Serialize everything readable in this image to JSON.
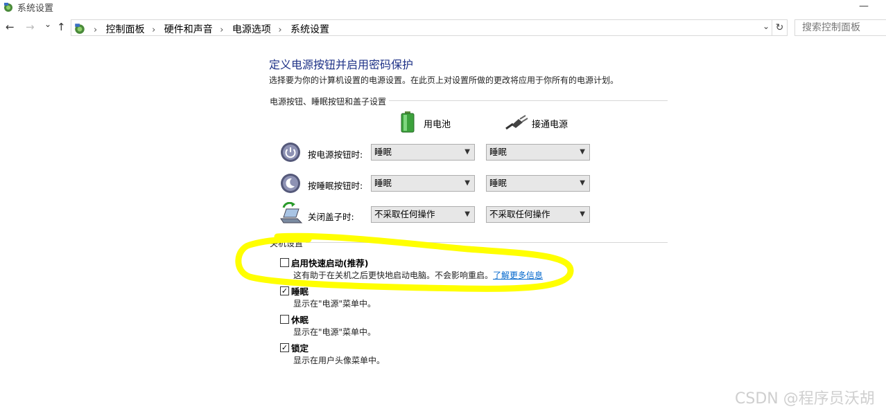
{
  "window": {
    "title": "系统设置",
    "minimize_glyph": "—"
  },
  "nav": {
    "back": "←",
    "forward": "→",
    "recent": "⌄",
    "up": "↑",
    "breadcrumbs": [
      "控制面板",
      "硬件和声音",
      "电源选项",
      "系统设置"
    ],
    "separator": "›",
    "dropdown_glyph": "⌄",
    "refresh_glyph": "↻",
    "search_placeholder": "搜索控制面板"
  },
  "page": {
    "heading": "定义电源按钮并启用密码保护",
    "description": "选择要为你的计算机设置的电源设置。在此页上对设置所做的更改将应用于你所有的电源计划。"
  },
  "power_buttons": {
    "group_label": "电源按钮、睡眠按钮和盖子设置",
    "columns": {
      "battery": "用电池",
      "plugged_in": "接通电源"
    },
    "rows": [
      {
        "icon": "power-button-icon",
        "label": "按电源按钮时:",
        "battery": "睡眠",
        "plugged_in": "睡眠"
      },
      {
        "icon": "sleep-button-icon",
        "label": "按睡眠按钮时:",
        "battery": "睡眠",
        "plugged_in": "睡眠"
      },
      {
        "icon": "laptop-lid-icon",
        "label": "关闭盖子时:",
        "battery": "不采取任何操作",
        "plugged_in": "不采取任何操作"
      }
    ],
    "select_arrow": "▼"
  },
  "shutdown": {
    "group_label": "关机设置",
    "items": [
      {
        "label": "启用快速启动(推荐)",
        "checked": false,
        "desc": "这有助于在关机之后更快地启动电脑。不会影响重启。",
        "link": "了解更多信息"
      },
      {
        "label": "睡眠",
        "checked": true,
        "desc": "显示在\"电源\"菜单中。"
      },
      {
        "label": "休眠",
        "checked": false,
        "desc": "显示在\"电源\"菜单中。"
      },
      {
        "label": "锁定",
        "checked": true,
        "desc": "显示在用户头像菜单中。"
      }
    ],
    "check_glyph": "✓"
  },
  "annotation": {
    "color": "#ffff00"
  },
  "watermark": "CSDN @程序员沃胡"
}
